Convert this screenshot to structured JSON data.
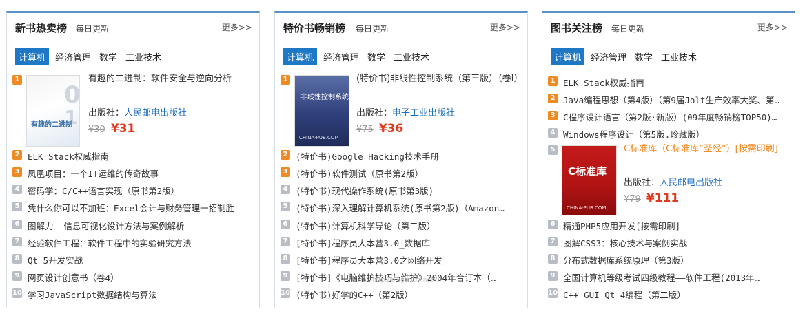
{
  "panels": [
    {
      "title": "新书热卖榜",
      "subtitle": "每日更新",
      "more": "更多>>",
      "tabs": [
        "计算机",
        "经济管理",
        "数学",
        "工业技术"
      ],
      "featured": {
        "rank": "1",
        "title": "有趣的二进制：软件安全与逆向分析",
        "publisher_label": "出版社：",
        "publisher": "人民邮电出版社",
        "old_price": "¥30",
        "new_price": "¥31",
        "cover_text": "有趣的二进制"
      },
      "items": [
        {
          "rank": "2",
          "title": "ELK Stack权威指南"
        },
        {
          "rank": "3",
          "title": "凤凰项目：一个IT运维的传奇故事"
        },
        {
          "rank": "4",
          "title": "密码学：C/C++语言实现（原书第2版）"
        },
        {
          "rank": "5",
          "title": "凭什么你可以不加班：Excel会计与财务管理一招制胜"
        },
        {
          "rank": "6",
          "title": "图解力——信息可视化设计方法与案例解析"
        },
        {
          "rank": "7",
          "title": "经验软件工程：软件工程中的实验研究方法"
        },
        {
          "rank": "8",
          "title": "Qt 5开发实战"
        },
        {
          "rank": "9",
          "title": "网页设计创意书（卷4）"
        },
        {
          "rank": "10",
          "title": "学习JavaScript数据结构与算法"
        }
      ]
    },
    {
      "title": "特价书畅销榜",
      "subtitle": "每日更新",
      "more": "更多>>",
      "tabs": [
        "计算机",
        "经济管理",
        "数学",
        "工业技术"
      ],
      "featured": {
        "rank": "1",
        "title": "(特价书)非线性控制系统（第三版）（卷I）",
        "publisher_label": "出版社：",
        "publisher": "电子工业出版社",
        "old_price": "¥75",
        "new_price": "¥36",
        "cover_text": "非线性控制系统",
        "cover_caption": "CHINA-PUB.COM"
      },
      "items": [
        {
          "rank": "2",
          "title": "(特价书)Google Hacking技术手册"
        },
        {
          "rank": "3",
          "title": "(特价书)软件测试（原书第2版）"
        },
        {
          "rank": "4",
          "title": "(特价书)现代操作系统(原书第3版)"
        },
        {
          "rank": "5",
          "title": "(特价书)深入理解计算机系统(原书第2版)（Amazon…"
        },
        {
          "rank": "6",
          "title": "(特价书)计算机科学导论（第二版）"
        },
        {
          "rank": "7",
          "title": "[特价书]程序员大本营3.0_数据库"
        },
        {
          "rank": "8",
          "title": "[特价书]程序员大本营3.0之网络开发"
        },
        {
          "rank": "9",
          "title": "[特价书]《电脑维护技巧与维护》2004年合订本（…"
        },
        {
          "rank": "10",
          "title": "(特价书)好学的C++（第2版）"
        }
      ]
    },
    {
      "title": "图书关注榜",
      "subtitle": "每日更新",
      "more": "更多>>",
      "tabs": [
        "计算机",
        "经济管理",
        "数学",
        "工业技术"
      ],
      "items_top": [
        {
          "rank": "1",
          "title": "ELK Stack权威指南"
        },
        {
          "rank": "2",
          "title": "Java编程思想（第4版）（第9届Jolt生产效率大奖、第…"
        },
        {
          "rank": "3",
          "title": "C程序设计语言（第2版·新版）(09年度畅销榜TOP50)…"
        },
        {
          "rank": "4",
          "title": "Windows程序设计（第5版.珍藏版）"
        }
      ],
      "featured": {
        "rank": "5",
        "title": "C标准库（C标准库“圣经”）[按需印刷]",
        "publisher_label": "出版社：",
        "publisher": "人民邮电出版社",
        "old_price": "¥79",
        "new_price": "¥111",
        "cover_text": "C标准库",
        "cover_caption": "CHINA-PUB.COM"
      },
      "items": [
        {
          "rank": "6",
          "title": "精通PHP5应用开发[按需印刷]"
        },
        {
          "rank": "7",
          "title": "图解CSS3：核心技术与案例实战"
        },
        {
          "rank": "8",
          "title": "分布式数据库系统原理（第3版）"
        },
        {
          "rank": "9",
          "title": "全国计算机等级考试四级教程——软件工程(2013年…"
        },
        {
          "rank": "10",
          "title": "C++ GUI Qt 4编程（第二版）"
        }
      ]
    }
  ],
  "watermark": "http://blog.csdn.net/...",
  "colors": {
    "accent": "#1f78c6",
    "rank_top": "#f08a24",
    "rank_low": "#b9bec6",
    "price": "#e03a1e",
    "link": "#1f6fbf"
  }
}
